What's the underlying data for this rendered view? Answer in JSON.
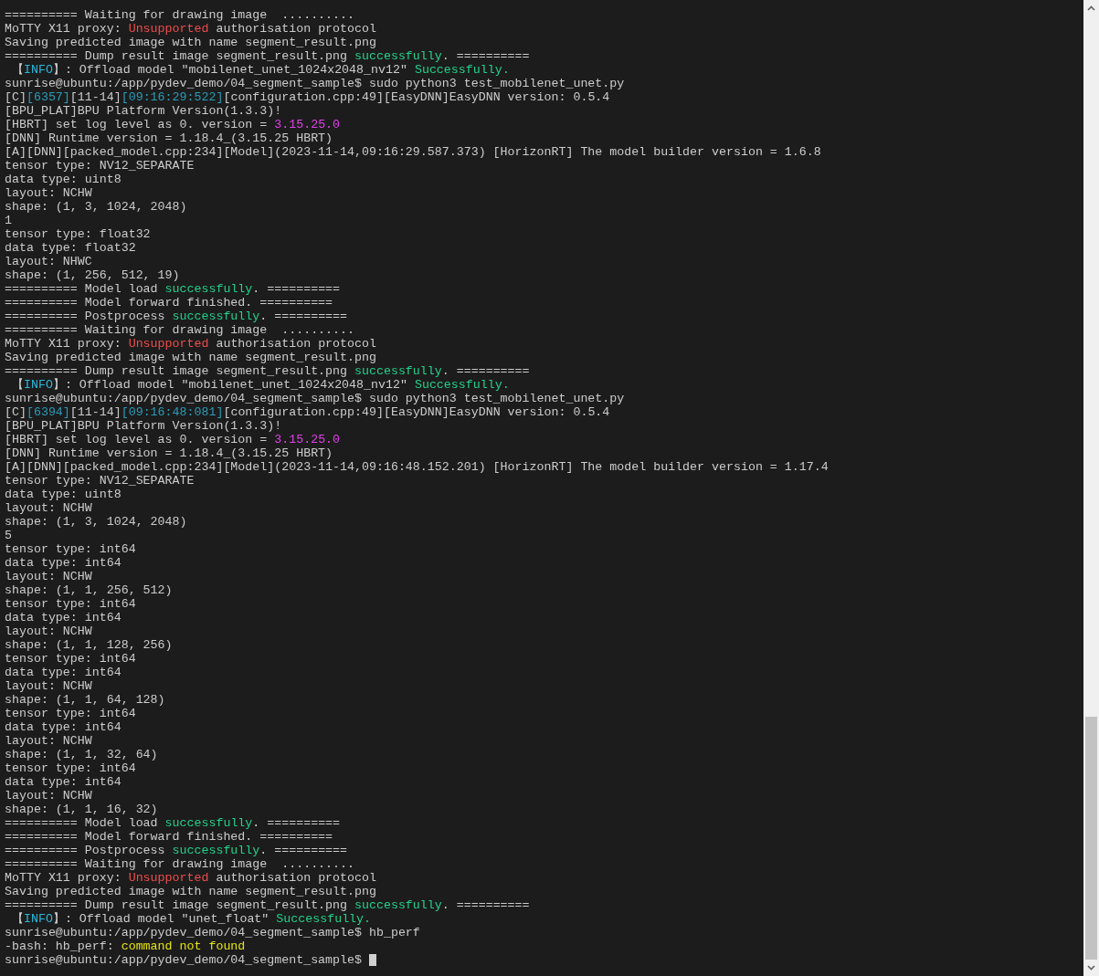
{
  "terminal": {
    "lines": [
      {
        "segments": [
          {
            "text": "========== Waiting for drawing image  .........."
          }
        ]
      },
      {
        "segments": [
          {
            "text": "MoTTY X11 proxy: "
          },
          {
            "text": "Unsupported",
            "color": "#f14c4c"
          },
          {
            "text": " authorisation protocol"
          }
        ]
      },
      {
        "segments": [
          {
            "text": "Saving predicted image with name segment_result.png"
          }
        ]
      },
      {
        "segments": [
          {
            "text": "========== Dump result image segment_result.png "
          },
          {
            "text": "successfully",
            "color": "#23d18b"
          },
          {
            "text": ". =========="
          }
        ]
      },
      {
        "segments": [
          {
            "text": " 【"
          },
          {
            "text": "INFO",
            "color": "#29b8db"
          },
          {
            "text": "】: Offload model \"mobilenet_unet_1024x2048_nv12\" "
          },
          {
            "text": "Successfully.",
            "color": "#23d18b"
          }
        ]
      },
      {
        "segments": [
          {
            "text": "sunrise@ubuntu:/app/pydev_demo/04_segment_sample$ sudo python3 test_mobilenet_unet.py"
          }
        ]
      },
      {
        "segments": [
          {
            "text": "[C]"
          },
          {
            "text": "[6357]",
            "color": "#2a9cb8"
          },
          {
            "text": "[11-14]"
          },
          {
            "text": "[09:16:29:522]",
            "color": "#2a9cb8"
          },
          {
            "text": "[configuration.cpp:49][EasyDNN]EasyDNN version: 0.5.4"
          }
        ]
      },
      {
        "segments": [
          {
            "text": "[BPU_PLAT]BPU Platform Version(1.3.3)!"
          }
        ]
      },
      {
        "segments": [
          {
            "text": "[HBRT] set log level as 0. version = "
          },
          {
            "text": "3.15.25.0",
            "color": "#e040e8"
          }
        ]
      },
      {
        "segments": [
          {
            "text": "[DNN] Runtime version = 1.18.4_(3.15.25 HBRT)"
          }
        ]
      },
      {
        "segments": [
          {
            "text": "[A][DNN][packed_model.cpp:234][Model](2023-11-14,09:16:29.587.373) [HorizonRT] The model builder version = 1.6.8"
          }
        ]
      },
      {
        "segments": [
          {
            "text": "tensor type: NV12_SEPARATE"
          }
        ]
      },
      {
        "segments": [
          {
            "text": "data type: uint8"
          }
        ]
      },
      {
        "segments": [
          {
            "text": "layout: NCHW"
          }
        ]
      },
      {
        "segments": [
          {
            "text": "shape: (1, 3, 1024, 2048)"
          }
        ]
      },
      {
        "segments": [
          {
            "text": "1"
          }
        ]
      },
      {
        "segments": [
          {
            "text": "tensor type: float32"
          }
        ]
      },
      {
        "segments": [
          {
            "text": "data type: float32"
          }
        ]
      },
      {
        "segments": [
          {
            "text": "layout: NHWC"
          }
        ]
      },
      {
        "segments": [
          {
            "text": "shape: (1, 256, 512, 19)"
          }
        ]
      },
      {
        "segments": [
          {
            "text": "========== Model load "
          },
          {
            "text": "successfully",
            "color": "#23d18b"
          },
          {
            "text": ". =========="
          }
        ]
      },
      {
        "segments": [
          {
            "text": "========== Model forward finished. =========="
          }
        ]
      },
      {
        "segments": [
          {
            "text": "========== Postprocess "
          },
          {
            "text": "successfully",
            "color": "#23d18b"
          },
          {
            "text": ". =========="
          }
        ]
      },
      {
        "segments": [
          {
            "text": "========== Waiting for drawing image  .........."
          }
        ]
      },
      {
        "segments": [
          {
            "text": "MoTTY X11 proxy: "
          },
          {
            "text": "Unsupported",
            "color": "#f14c4c"
          },
          {
            "text": " authorisation protocol"
          }
        ]
      },
      {
        "segments": [
          {
            "text": "Saving predicted image with name segment_result.png"
          }
        ]
      },
      {
        "segments": [
          {
            "text": "========== Dump result image segment_result.png "
          },
          {
            "text": "successfully",
            "color": "#23d18b"
          },
          {
            "text": ". =========="
          }
        ]
      },
      {
        "segments": [
          {
            "text": " 【"
          },
          {
            "text": "INFO",
            "color": "#29b8db"
          },
          {
            "text": "】: Offload model \"mobilenet_unet_1024x2048_nv12\" "
          },
          {
            "text": "Successfully.",
            "color": "#23d18b"
          }
        ]
      },
      {
        "segments": [
          {
            "text": "sunrise@ubuntu:/app/pydev_demo/04_segment_sample$ sudo python3 test_mobilenet_unet.py"
          }
        ]
      },
      {
        "segments": [
          {
            "text": "[C]"
          },
          {
            "text": "[6394]",
            "color": "#2a9cb8"
          },
          {
            "text": "[11-14]"
          },
          {
            "text": "[09:16:48:081]",
            "color": "#2a9cb8"
          },
          {
            "text": "[configuration.cpp:49][EasyDNN]EasyDNN version: 0.5.4"
          }
        ]
      },
      {
        "segments": [
          {
            "text": "[BPU_PLAT]BPU Platform Version(1.3.3)!"
          }
        ]
      },
      {
        "segments": [
          {
            "text": "[HBRT] set log level as 0. version = "
          },
          {
            "text": "3.15.25.0",
            "color": "#e040e8"
          }
        ]
      },
      {
        "segments": [
          {
            "text": "[DNN] Runtime version = 1.18.4_(3.15.25 HBRT)"
          }
        ]
      },
      {
        "segments": [
          {
            "text": "[A][DNN][packed_model.cpp:234][Model](2023-11-14,09:16:48.152.201) [HorizonRT] The model builder version = 1.17.4"
          }
        ]
      },
      {
        "segments": [
          {
            "text": "tensor type: NV12_SEPARATE"
          }
        ]
      },
      {
        "segments": [
          {
            "text": "data type: uint8"
          }
        ]
      },
      {
        "segments": [
          {
            "text": "layout: NCHW"
          }
        ]
      },
      {
        "segments": [
          {
            "text": "shape: (1, 3, 1024, 2048)"
          }
        ]
      },
      {
        "segments": [
          {
            "text": "5"
          }
        ]
      },
      {
        "segments": [
          {
            "text": "tensor type: int64"
          }
        ]
      },
      {
        "segments": [
          {
            "text": "data type: int64"
          }
        ]
      },
      {
        "segments": [
          {
            "text": "layout: NCHW"
          }
        ]
      },
      {
        "segments": [
          {
            "text": "shape: (1, 1, 256, 512)"
          }
        ]
      },
      {
        "segments": [
          {
            "text": "tensor type: int64"
          }
        ]
      },
      {
        "segments": [
          {
            "text": "data type: int64"
          }
        ]
      },
      {
        "segments": [
          {
            "text": "layout: NCHW"
          }
        ]
      },
      {
        "segments": [
          {
            "text": "shape: (1, 1, 128, 256)"
          }
        ]
      },
      {
        "segments": [
          {
            "text": "tensor type: int64"
          }
        ]
      },
      {
        "segments": [
          {
            "text": "data type: int64"
          }
        ]
      },
      {
        "segments": [
          {
            "text": "layout: NCHW"
          }
        ]
      },
      {
        "segments": [
          {
            "text": "shape: (1, 1, 64, 128)"
          }
        ]
      },
      {
        "segments": [
          {
            "text": "tensor type: int64"
          }
        ]
      },
      {
        "segments": [
          {
            "text": "data type: int64"
          }
        ]
      },
      {
        "segments": [
          {
            "text": "layout: NCHW"
          }
        ]
      },
      {
        "segments": [
          {
            "text": "shape: (1, 1, 32, 64)"
          }
        ]
      },
      {
        "segments": [
          {
            "text": "tensor type: int64"
          }
        ]
      },
      {
        "segments": [
          {
            "text": "data type: int64"
          }
        ]
      },
      {
        "segments": [
          {
            "text": "layout: NCHW"
          }
        ]
      },
      {
        "segments": [
          {
            "text": "shape: (1, 1, 16, 32)"
          }
        ]
      },
      {
        "segments": [
          {
            "text": "========== Model load "
          },
          {
            "text": "successfully",
            "color": "#23d18b"
          },
          {
            "text": ". =========="
          }
        ]
      },
      {
        "segments": [
          {
            "text": "========== Model forward finished. =========="
          }
        ]
      },
      {
        "segments": [
          {
            "text": "========== Postprocess "
          },
          {
            "text": "successfully",
            "color": "#23d18b"
          },
          {
            "text": ". =========="
          }
        ]
      },
      {
        "segments": [
          {
            "text": "========== Waiting for drawing image  .........."
          }
        ]
      },
      {
        "segments": [
          {
            "text": "MoTTY X11 proxy: "
          },
          {
            "text": "Unsupported",
            "color": "#f14c4c"
          },
          {
            "text": " authorisation protocol"
          }
        ]
      },
      {
        "segments": [
          {
            "text": "Saving predicted image with name segment_result.png"
          }
        ]
      },
      {
        "segments": [
          {
            "text": "========== Dump result image segment_result.png "
          },
          {
            "text": "successfully",
            "color": "#23d18b"
          },
          {
            "text": ". =========="
          }
        ]
      },
      {
        "segments": [
          {
            "text": " 【"
          },
          {
            "text": "INFO",
            "color": "#29b8db"
          },
          {
            "text": "】: Offload model \"unet_float\" "
          },
          {
            "text": "Successfully.",
            "color": "#23d18b"
          }
        ]
      },
      {
        "segments": [
          {
            "text": "sunrise@ubuntu:/app/pydev_demo/04_segment_sample$ hb_perf"
          }
        ]
      },
      {
        "segments": [
          {
            "text": "-bash: hb_perf: "
          },
          {
            "text": "command not found",
            "color": "#e5e510"
          }
        ]
      },
      {
        "segments": [
          {
            "text": "sunrise@ubuntu:/app/pydev_demo/04_segment_sample$ "
          }
        ],
        "cursor": true
      }
    ]
  }
}
